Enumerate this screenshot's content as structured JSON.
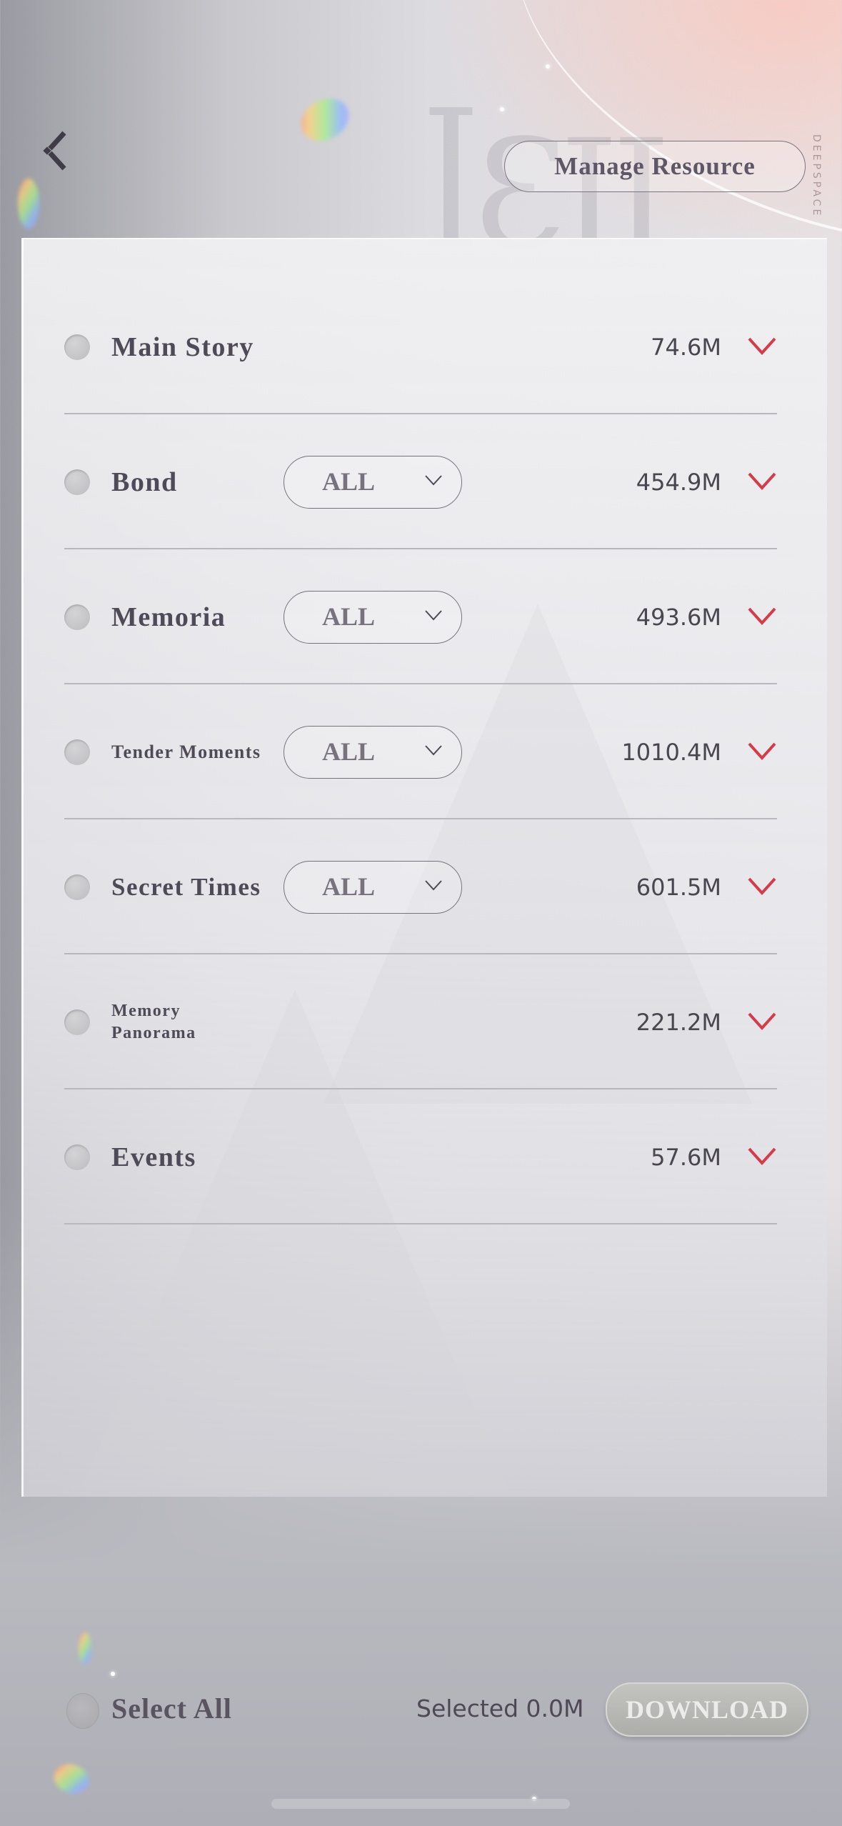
{
  "header": {
    "back_icon": "back-chevron-icon",
    "manage_resource_label": "Manage Resource",
    "brand_vertical": "DEEPSPACE"
  },
  "colors": {
    "accent_red": "#d23c4b",
    "text_dark": "#4f4a57",
    "download_bg": "#b8b8b5"
  },
  "categories": [
    {
      "label": "Main Story",
      "size": "74.6M",
      "filter": null,
      "selected": false
    },
    {
      "label": "Bond",
      "size": "454.9M",
      "filter": "ALL",
      "selected": false
    },
    {
      "label": "Memoria",
      "size": "493.6M",
      "filter": "ALL",
      "selected": false
    },
    {
      "label": "Tender Moments",
      "size": "1010.4M",
      "filter": "ALL",
      "selected": false
    },
    {
      "label": "Secret Times",
      "size": "601.5M",
      "filter": "ALL",
      "selected": false
    },
    {
      "label_line1": "Memory",
      "label_line2": "Panorama",
      "label": "Memory Panorama",
      "size": "221.2M",
      "filter": null,
      "selected": false
    },
    {
      "label": "Events",
      "size": "57.6M",
      "filter": null,
      "selected": false
    }
  ],
  "footer": {
    "select_all_label": "Select All",
    "selected_label": "Selected 0.0M",
    "download_label": "DOWNLOAD"
  }
}
